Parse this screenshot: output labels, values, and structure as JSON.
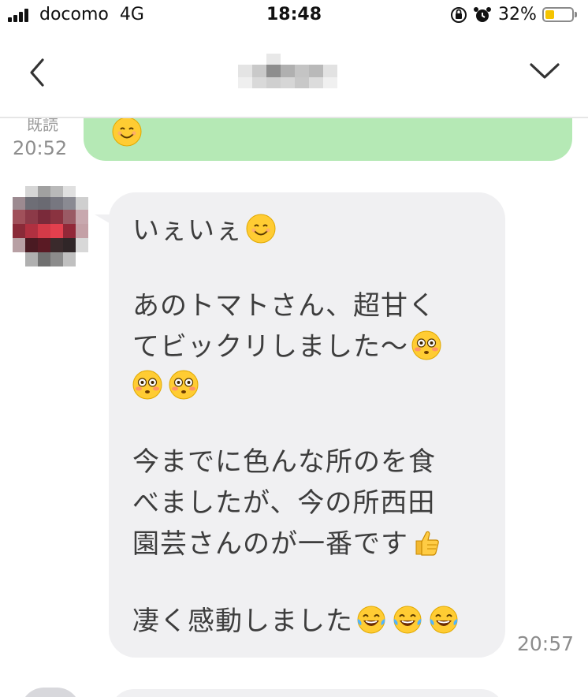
{
  "status_bar": {
    "carrier": "docomo",
    "network": "4G",
    "time": "18:48",
    "battery_percent": "32%",
    "icons": [
      "signal-icon",
      "orientation-lock-icon",
      "alarm-icon",
      "battery-icon"
    ],
    "battery_level": 0.32
  },
  "header": {
    "back_icon": "chevron-left-icon",
    "menu_icon": "chevron-down-icon",
    "title_pixelated": true
  },
  "messages": {
    "outgoing": {
      "read_label": "既読",
      "time": "20:52",
      "emoji": "😊"
    },
    "incoming": {
      "avatar_pixelated": true,
      "lines": [
        "いぇいぇ",
        "",
        "あのトマトさん、超甘く",
        "てビックリしました〜",
        "",
        "",
        "今までに色んな所のを食",
        "べましたが、今の所西田",
        "園芸さんのが一番です",
        "",
        "凄く感動しました"
      ],
      "time": "20:57"
    }
  },
  "colors": {
    "outgoing_bubble": "#b5e9b5",
    "incoming_bubble": "#f0f0f2",
    "timestamp": "#8d8d8d"
  }
}
